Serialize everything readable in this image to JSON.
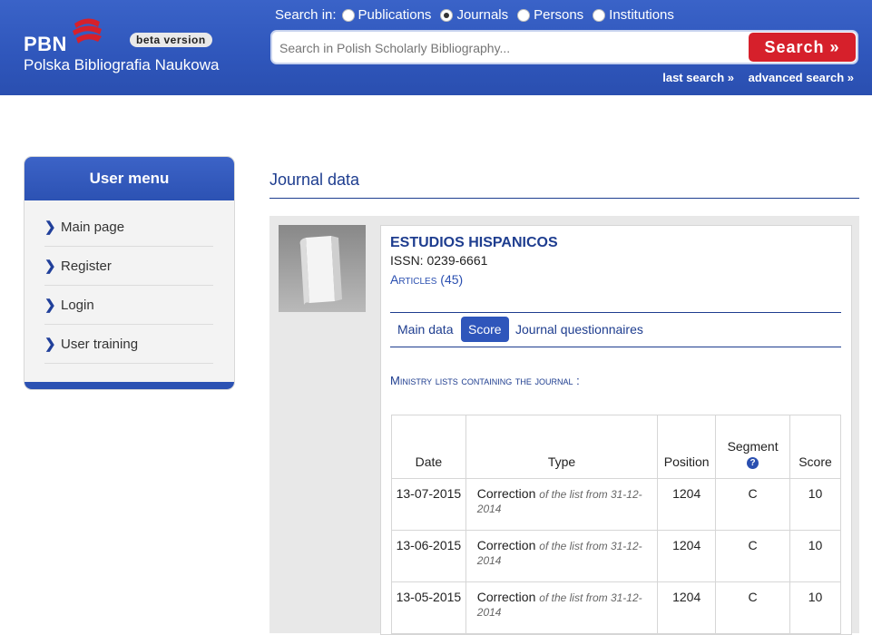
{
  "header": {
    "logo_short": "PBN",
    "logo_full": "Polska Bibliografia Naukowa",
    "beta_label": "beta version",
    "search_in_label": "Search in:",
    "radios": [
      {
        "label": "Publications",
        "selected": false
      },
      {
        "label": "Journals",
        "selected": true
      },
      {
        "label": "Persons",
        "selected": false
      },
      {
        "label": "Institutions",
        "selected": false
      }
    ],
    "search_placeholder": "Search in Polish Scholarly Bibliography...",
    "search_button": "Search",
    "last_search": "last search »",
    "advanced_search": "advanced search »"
  },
  "sidebar": {
    "title": "User menu",
    "items": [
      {
        "label": "Main page"
      },
      {
        "label": "Register"
      },
      {
        "label": "Login"
      },
      {
        "label": "User training"
      }
    ]
  },
  "main": {
    "title": "Journal data",
    "journal_title": "ESTUDIOS HISPANICOS",
    "issn": "ISSN: 0239-6661",
    "articles": "Articles (45)",
    "tabs": [
      {
        "label": "Main data",
        "active": false
      },
      {
        "label": "Score",
        "active": true
      },
      {
        "label": "Journal questionnaires",
        "active": false
      }
    ],
    "ministry_label": "Ministry lists containing the journal :",
    "table": {
      "headers": {
        "date": "Date",
        "type": "Type",
        "position": "Position",
        "segment": "Segment",
        "score": "Score"
      },
      "rows": [
        {
          "date": "13-07-2015",
          "type": "Correction",
          "note": "of the list from 31-12-2014",
          "position": "1204",
          "segment": "C",
          "score": "10"
        },
        {
          "date": "13-06-2015",
          "type": "Correction",
          "note": "of the list from 31-12-2014",
          "position": "1204",
          "segment": "C",
          "score": "10"
        },
        {
          "date": "13-05-2015",
          "type": "Correction",
          "note": "of the list from 31-12-2014",
          "position": "1204",
          "segment": "C",
          "score": "10"
        }
      ]
    }
  },
  "colors": {
    "brand_blue": "#2f56bb",
    "search_red": "#d6202b",
    "link_blue": "#1e3d8f"
  }
}
